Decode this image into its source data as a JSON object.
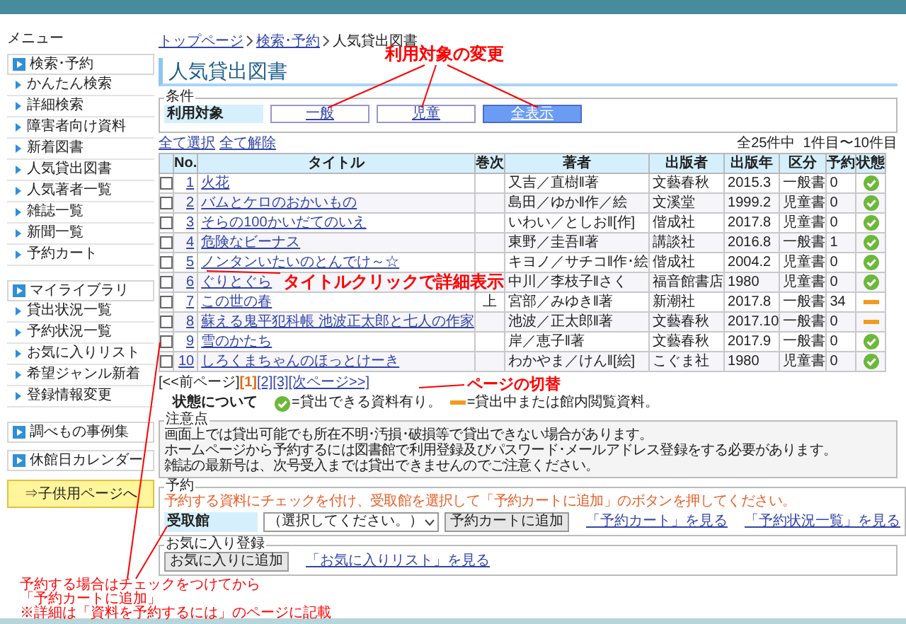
{
  "menu_label": "メニュー",
  "sidebar": {
    "sections": [
      {
        "title": "検索･予約",
        "items": [
          "かんたん検索",
          "詳細検索",
          "障害者向け資料",
          "新着図書",
          "人気貸出図書",
          "人気著者一覧",
          "雑誌一覧",
          "新聞一覧",
          "予約カート"
        ]
      },
      {
        "title": "マイライブラリ",
        "items": [
          "貸出状況一覧",
          "予約状況一覧",
          "お気に入りリスト",
          "希望ジャンル新着",
          "登録情報変更"
        ]
      }
    ],
    "links": [
      "調べもの事例集",
      "休館日カレンダー"
    ],
    "kids_button": "⇒子供用ページへ"
  },
  "breadcrumb": [
    {
      "label": "トップページ",
      "kind": "link"
    },
    {
      "label": "検索･予約",
      "kind": "link"
    },
    {
      "label": "人気貸出図書",
      "kind": "current"
    }
  ],
  "page_title": "人気貸出図書",
  "conditions": {
    "legend": "条件",
    "label": "利用対象",
    "options": [
      {
        "label": "一般",
        "selected": false
      },
      {
        "label": "児童",
        "selected": false
      },
      {
        "label": "全表示",
        "selected": true
      }
    ]
  },
  "select_all": "全て選択",
  "deselect_all": "全て解除",
  "count": "全25件中  1件目〜10件目",
  "table": {
    "columns": [
      "No.",
      "タイトル",
      "巻次",
      "著者",
      "出版者",
      "出版年",
      "区分",
      "予約",
      "状態"
    ],
    "rows": [
      {
        "checked": false,
        "no": "1",
        "title": "火花",
        "author": "又吉／直樹‖著",
        "publisher": "文藝春秋",
        "year": "2015.3",
        "category": "一般書",
        "reservations": "0",
        "available": true
      },
      {
        "checked": false,
        "no": "2",
        "title": "バムとケロのおかいもの",
        "author": "島田／ゆか‖作／絵",
        "publisher": "文溪堂",
        "year": "1999.2",
        "category": "児童書",
        "reservations": "0",
        "available": true
      },
      {
        "checked": false,
        "no": "3",
        "title": "そらの100かいだてのいえ",
        "author": "いわい／としお‖[作]",
        "publisher": "偕成社",
        "year": "2017.8",
        "category": "児童書",
        "reservations": "0",
        "available": true
      },
      {
        "checked": false,
        "no": "4",
        "title": "危険なビーナス",
        "author": "東野／圭吾‖著",
        "publisher": "講談社",
        "year": "2016.8",
        "category": "一般書",
        "reservations": "1",
        "available": true
      },
      {
        "checked": false,
        "no": "5",
        "title": "ノンタンいたいのとんでけ～☆",
        "author": "キヨノ／サチコ‖作･絵",
        "publisher": "偕成社",
        "year": "2004.2",
        "category": "児童書",
        "reservations": "0",
        "available": true
      },
      {
        "checked": false,
        "no": "6",
        "title": "ぐりとぐら",
        "author": "中川／李枝子‖さく",
        "publisher": "福音館書店",
        "year": "1980",
        "category": "児童書",
        "reservations": "0",
        "available": true
      },
      {
        "checked": false,
        "no": "7",
        "title": "この世の春",
        "volume": "上",
        "author": "宮部／みゆき‖著",
        "publisher": "新潮社",
        "year": "2017.8",
        "category": "一般書",
        "reservations": "34",
        "available": false
      },
      {
        "checked": false,
        "no": "8",
        "title": "蘇える鬼平犯科帳 池波正太郎と七人の作家",
        "author": "池波／正太郎‖著",
        "publisher": "文藝春秋",
        "year": "2017.10",
        "category": "一般書",
        "reservations": "0",
        "available": false
      },
      {
        "checked": false,
        "no": "9",
        "title": "雪のかたち",
        "author": "岸／恵子‖著",
        "publisher": "文藝春秋",
        "year": "2017.9",
        "category": "一般書",
        "reservations": "0",
        "available": true
      },
      {
        "checked": false,
        "no": "10",
        "title": "しろくまちゃんのほっとけーき",
        "author": "わかやま／けん‖[絵]",
        "publisher": "こぐま社",
        "year": "1980",
        "category": "児童書",
        "reservations": "0",
        "available": true
      }
    ]
  },
  "pagination": {
    "prev": "[<<前ページ]",
    "pages": [
      {
        "label": "[1]",
        "selected": true
      },
      {
        "label": "[2]",
        "selected": false
      },
      {
        "label": "[3]",
        "selected": false
      }
    ],
    "next": "[次ページ>>]"
  },
  "status_legend": {
    "label": "状態について",
    "items": [
      {
        "kind": "available",
        "text": "=貸出できる資料有り。"
      },
      {
        "kind": "on_loan",
        "text": "=貸出中または館内閲覧資料。"
      }
    ]
  },
  "notes": {
    "legend": "注意点",
    "lines": [
      "画面上では貸出可能でも所在不明･汚損･破損等で貸出できない場合があります。",
      "ホームページから予約するには図書館で利用登録及びパスワード･メールアドレス登録をする必要があります。",
      "雑誌の最新号は、次号受入までは貸出できませんのでご注意ください。"
    ]
  },
  "reserve": {
    "legend": "予約",
    "instruction": "予約する資料にチェックを付け、受取館を選択して「予約カートに追加」のボタンを押してください。",
    "label": "受取館",
    "select_value": "（選択してください。）",
    "button": "予約カートに追加",
    "links": [
      "「予約カート」を見る",
      "「予約状況一覧」を見る"
    ]
  },
  "favorites": {
    "legend": "お気に入り登録",
    "button": "お気に入りに追加",
    "link": "「お気に入りリスト」を見る"
  },
  "annotations": [
    {
      "kind": "conditions",
      "lines": [
        "利用対象の変更"
      ]
    },
    {
      "kind": "title",
      "lines": [
        "タイトルクリックで詳細表示"
      ]
    },
    {
      "kind": "pagination",
      "lines": [
        "ページの切替"
      ]
    },
    {
      "kind": "reserve",
      "lines": [
        "予約する場合はチェックをつけてから",
        "「予約カートに追加」",
        "※詳細は「資料を予約するには」のページに記載"
      ]
    }
  ]
}
